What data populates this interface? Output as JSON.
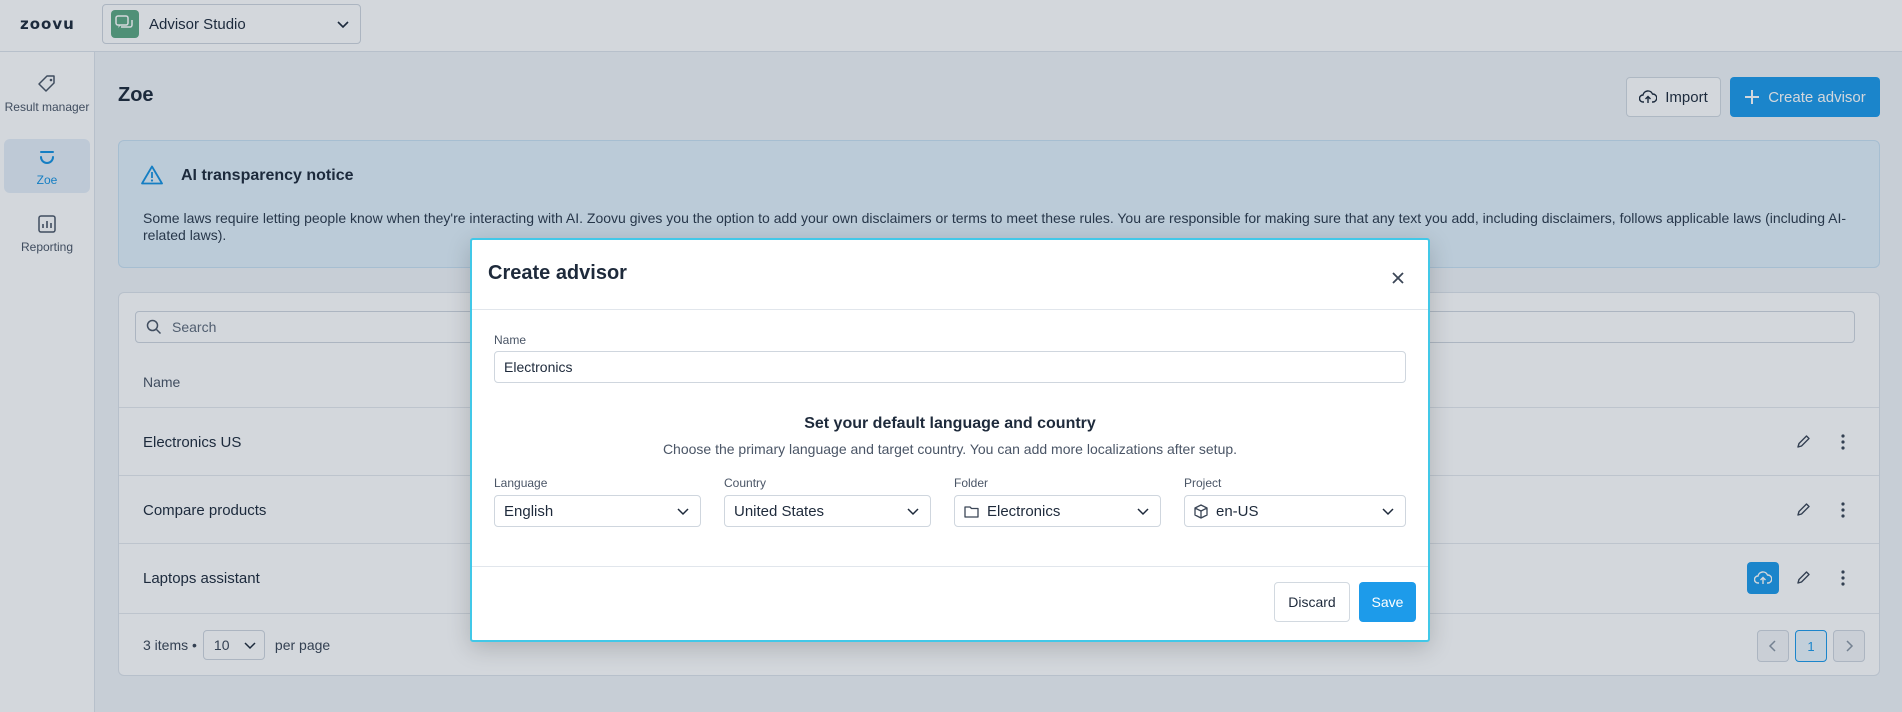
{
  "app": {
    "logo": "zoovu",
    "switcher_label": "Advisor Studio",
    "switcher_icon": "chat-bubbles-icon"
  },
  "sidebar": {
    "items": [
      {
        "label": "Result manager",
        "icon": "tag-icon",
        "active": false
      },
      {
        "label": "Zoe",
        "icon": "zoe-icon",
        "active": true
      },
      {
        "label": "Reporting",
        "icon": "chart-icon",
        "active": false
      }
    ]
  },
  "page": {
    "title": "Zoe",
    "import_label": "Import",
    "create_label": "Create advisor"
  },
  "notice": {
    "title": "AI transparency notice",
    "text": "Some laws require letting people know when they're interacting with AI. Zoovu gives you the option to add your own disclaimers or terms to meet these rules. You are responsible for making sure that any text you add, including disclaimers, follows applicable laws (including AI-related laws)."
  },
  "table": {
    "search_placeholder": "Search",
    "column_name": "Name",
    "rows": [
      {
        "name": "Electronics US"
      },
      {
        "name": "Compare products"
      },
      {
        "name": "Laptops assistant"
      }
    ],
    "items_text": "3 items •",
    "per_page_value": "10",
    "per_page_label": "per page",
    "current_page": "1"
  },
  "modal": {
    "title": "Create advisor",
    "name_label": "Name",
    "name_value": "Electronics",
    "section_title": "Set your default language and country",
    "section_subtitle": "Choose the primary language and target country. You can add more localizations after setup.",
    "language_label": "Language",
    "language_value": "English",
    "country_label": "Country",
    "country_value": "United States",
    "folder_label": "Folder",
    "folder_value": "Electronics",
    "project_label": "Project",
    "project_value": "en-US",
    "discard_label": "Discard",
    "save_label": "Save"
  },
  "colors": {
    "accent": "#1d9bea",
    "modal_border": "#41c8e8",
    "app_icon": "#5da883"
  }
}
